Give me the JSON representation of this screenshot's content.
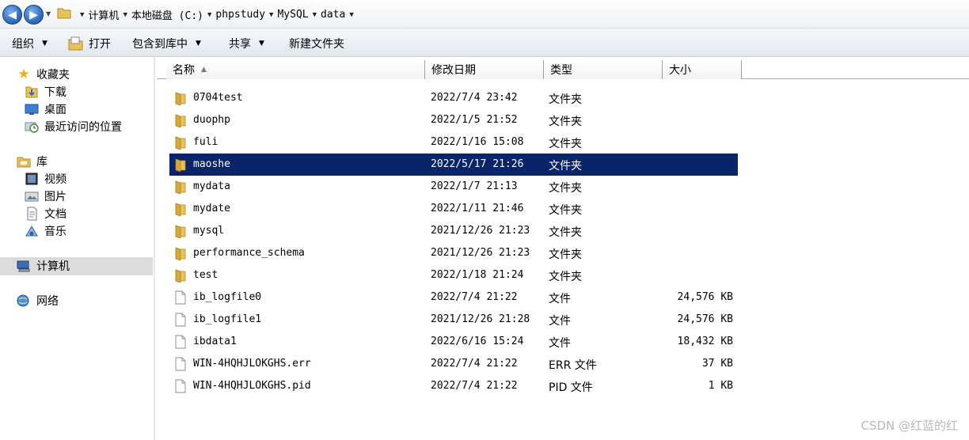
{
  "address_bar": {
    "breadcrumbs": [
      "计算机",
      "本地磁盘 (C:)",
      "phpstudy",
      "MySQL",
      "data"
    ]
  },
  "toolbar": {
    "organize": "组织",
    "open": "打开",
    "include_in_library": "包含到库中",
    "share": "共享",
    "new_folder": "新建文件夹"
  },
  "sidebar": {
    "favorites": {
      "label": "收藏夹",
      "items": [
        "下载",
        "桌面",
        "最近访问的位置"
      ]
    },
    "libraries": {
      "label": "库",
      "items": [
        "视频",
        "图片",
        "文档",
        "音乐"
      ]
    },
    "computer": "计算机",
    "network": "网络"
  },
  "columns": {
    "name": "名称",
    "modified": "修改日期",
    "type": "类型",
    "size": "大小"
  },
  "files": [
    {
      "name": "0704test",
      "modified": "2022/7/4 23:42",
      "type": "文件夹",
      "size": "",
      "kind": "folder"
    },
    {
      "name": "duophp",
      "modified": "2022/1/5 21:52",
      "type": "文件夹",
      "size": "",
      "kind": "folder"
    },
    {
      "name": "fuli",
      "modified": "2022/1/16 15:08",
      "type": "文件夹",
      "size": "",
      "kind": "folder"
    },
    {
      "name": "maoshe",
      "modified": "2022/5/17 21:26",
      "type": "文件夹",
      "size": "",
      "kind": "folder",
      "selected": true
    },
    {
      "name": "mydata",
      "modified": "2022/1/7 21:13",
      "type": "文件夹",
      "size": "",
      "kind": "folder"
    },
    {
      "name": "mydate",
      "modified": "2022/1/11 21:46",
      "type": "文件夹",
      "size": "",
      "kind": "folder"
    },
    {
      "name": "mysql",
      "modified": "2021/12/26 21:23",
      "type": "文件夹",
      "size": "",
      "kind": "folder"
    },
    {
      "name": "performance_schema",
      "modified": "2021/12/26 21:23",
      "type": "文件夹",
      "size": "",
      "kind": "folder"
    },
    {
      "name": "test",
      "modified": "2022/1/18 21:24",
      "type": "文件夹",
      "size": "",
      "kind": "folder"
    },
    {
      "name": "ib_logfile0",
      "modified": "2022/7/4 21:22",
      "type": "文件",
      "size": "24,576 KB",
      "kind": "file"
    },
    {
      "name": "ib_logfile1",
      "modified": "2021/12/26 21:28",
      "type": "文件",
      "size": "24,576 KB",
      "kind": "file"
    },
    {
      "name": "ibdata1",
      "modified": "2022/6/16 15:24",
      "type": "文件",
      "size": "18,432 KB",
      "kind": "file"
    },
    {
      "name": "WIN-4HQHJLOKGHS.err",
      "modified": "2022/7/4 21:22",
      "type": "ERR 文件",
      "size": "37 KB",
      "kind": "file"
    },
    {
      "name": "WIN-4HQHJLOKGHS.pid",
      "modified": "2022/7/4 21:22",
      "type": "PID 文件",
      "size": "1 KB",
      "kind": "file"
    }
  ],
  "watermark": "CSDN @红蓝的红",
  "colors": {
    "selection": "#0a246a",
    "folder": "#e9c35a"
  }
}
